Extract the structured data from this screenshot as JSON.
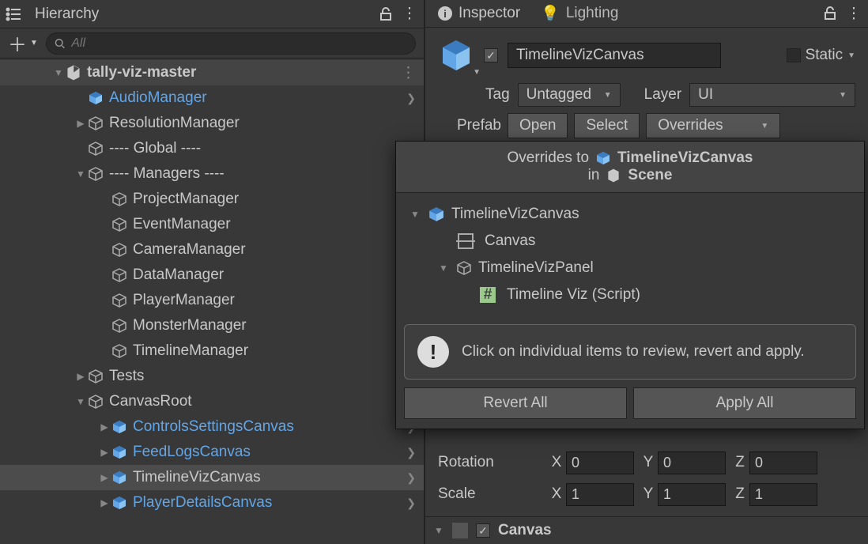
{
  "hierarchy": {
    "title": "Hierarchy",
    "search_placeholder": "All",
    "scene": "tally-viz-master",
    "items": {
      "audio": "AudioManager",
      "resolution": "ResolutionManager",
      "global": "---- Global ----",
      "managers": "---- Managers ----",
      "project_mgr": "ProjectManager",
      "event_mgr": "EventManager",
      "camera_mgr": "CameraManager",
      "data_mgr": "DataManager",
      "player_mgr": "PlayerManager",
      "monster_mgr": "MonsterManager",
      "timeline_mgr": "TimelineManager",
      "tests": "Tests",
      "canvas_root": "CanvasRoot",
      "controls_canvas": "ControlsSettingsCanvas",
      "feed_logs": "FeedLogsCanvas",
      "timeline_viz": "TimelineVizCanvas",
      "player_details": "PlayerDetailsCanvas"
    }
  },
  "inspector": {
    "tab": "Inspector",
    "lighting_tab": "Lighting",
    "name": "TimelineVizCanvas",
    "static": "Static",
    "tag_label": "Tag",
    "tag_value": "Untagged",
    "layer_label": "Layer",
    "layer_value": "UI",
    "prefab_label": "Prefab",
    "open": "Open",
    "select": "Select",
    "overrides": "Overrides",
    "rotation": "Rotation",
    "scale": "Scale",
    "rx": "0",
    "ry": "0",
    "rz": "0",
    "sx": "1",
    "sy": "1",
    "sz": "1",
    "canvas_comp": "Canvas"
  },
  "overrides_popover": {
    "title_prefix": "Overrides to",
    "title_target": "TimelineVizCanvas",
    "in": "in",
    "scene": "Scene",
    "root": "TimelineVizCanvas",
    "canvas": "Canvas",
    "panel": "TimelineVizPanel",
    "script": "Timeline Viz (Script)",
    "notice": "Click on individual items to review, revert and apply.",
    "revert": "Revert All",
    "apply": "Apply All"
  }
}
